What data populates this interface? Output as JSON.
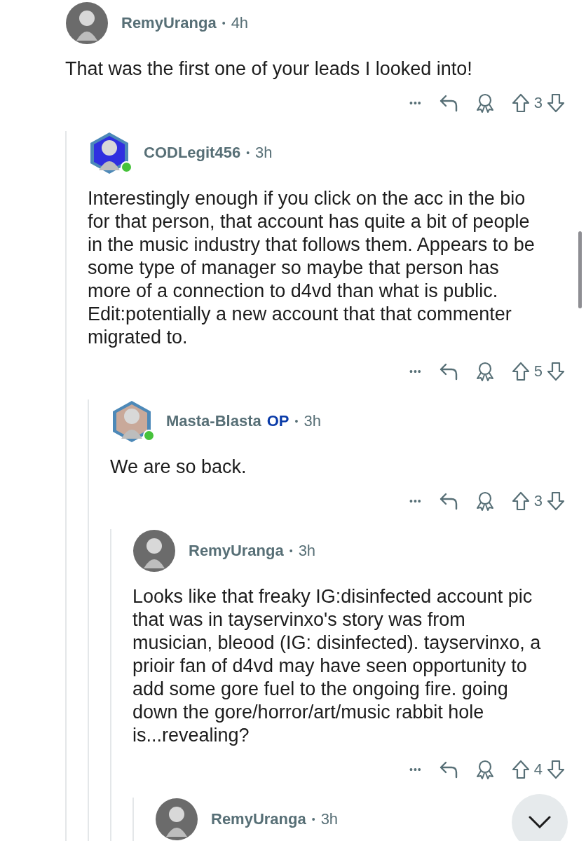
{
  "comments": [
    {
      "author": "RemyUranga",
      "op": false,
      "separator": "•",
      "time": "4h",
      "kind": "round",
      "online": false,
      "body": "That was the first one of your leads I looked into!",
      "more": "•••",
      "score": "3",
      "children": [
        {
          "author": "CODLegit456",
          "op": false,
          "separator": "•",
          "time": "3h",
          "kind": "hexagon",
          "online": true,
          "body": "Interestingly enough if you click on the acc in the bio for that person, that account has quite a bit of people in the music industry that follows them. Appears to be some type of manager so maybe that person has more of a connection to d4vd than what is public. Edit:potentially a new account that that commenter migrated to.",
          "more": "•••",
          "score": "5",
          "children": [
            {
              "author": "Masta-Blasta",
              "op": true,
              "op_label": "OP",
              "separator": "•",
              "time": "3h",
              "kind": "hexagon",
              "online": true,
              "body": "We are so back.",
              "more": "•••",
              "score": "3",
              "children": [
                {
                  "author": "RemyUranga",
                  "op": false,
                  "separator": "•",
                  "time": "3h",
                  "kind": "round",
                  "online": false,
                  "body": "Looks like that freaky IG:disinfected account pic that was in tayservinxo's story was from musician, bleood (IG: disinfected). tayservinxo, a prioir fan of d4vd may have seen opportunity to add some gore fuel to the ongoing fire. going down the gore/horror/art/music rabbit hole is...revealing?",
                  "more": "•••",
                  "score": "4",
                  "children": [
                    {
                      "author": "RemyUranga",
                      "op": false,
                      "separator": "•",
                      "time": "3h",
                      "kind": "round",
                      "online": false
                    }
                  ]
                }
              ]
            }
          ]
        }
      ]
    }
  ]
}
